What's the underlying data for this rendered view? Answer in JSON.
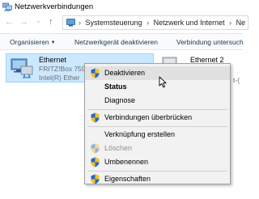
{
  "window": {
    "title": "Netzwerkverbindungen",
    "icons": {
      "app": "network-connections-icon"
    }
  },
  "nav": {
    "back": "←",
    "forward": "→",
    "recent": "⌄",
    "up": "↑"
  },
  "address": {
    "crumb_sep": "›",
    "crumbs": [
      "Systemsteuerung",
      "Netzwerk und Internet",
      "Ne"
    ]
  },
  "commands": {
    "organize": "Organisieren",
    "organize_caret": "▼",
    "deactivate_device": "Netzwerkgerät deaktivieren",
    "diagnose_connection": "Verbindung untersuch"
  },
  "connections": [
    {
      "name": "Ethernet",
      "line1": "FRITZ!Box 759",
      "line2": "Intel(R) Ether",
      "selected": true
    },
    {
      "name": "Ethernet 2",
      "line1": "",
      "line2": "t-("
    }
  ],
  "context_menu": {
    "items": [
      {
        "label": "Deaktivieren",
        "shield": true
      },
      {
        "label": "Status",
        "bold": true
      },
      {
        "label": "Diagnose"
      },
      {
        "label": "Verbindungen überbrücken",
        "shield": true
      },
      {
        "label": "Verknüpfung erstellen"
      },
      {
        "label": "Löschen",
        "shield": true,
        "disabled": true
      },
      {
        "label": "Umbenennen",
        "shield": true
      },
      {
        "label": "Eigenschaften",
        "shield": true
      }
    ]
  },
  "colors": {
    "selection_fill": "#cce8ff",
    "selection_border": "#99d1ff",
    "menu_bg": "#f2f2f2",
    "shield_blue": "#2b66c9",
    "shield_yellow": "#f3c21b"
  }
}
